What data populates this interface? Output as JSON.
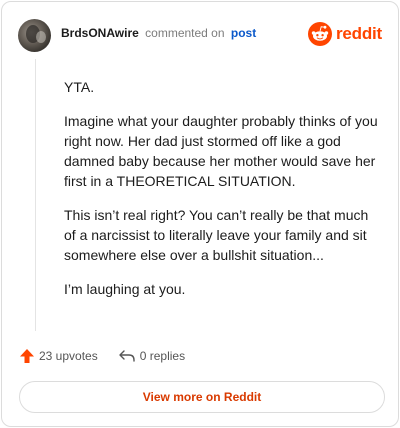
{
  "header": {
    "username": "BrdsONAwire",
    "action_text": "commented on",
    "post_link": "post",
    "brand": "reddit"
  },
  "comment": {
    "paragraphs": [
      "YTA.",
      "Imagine what your daughter probably thinks of you right now. Her dad just stormed off like a god damned baby because her mother would save her first in a THEORETICAL SITUATION.",
      "This isn’t real right? You can’t really be that much of a narcissist to literally leave your family and sit somewhere else over a bullshit situation...",
      "I’m laughing at you."
    ]
  },
  "footer": {
    "upvotes": "23 upvotes",
    "replies": "0 replies"
  },
  "view_more": "View more on Reddit",
  "colors": {
    "brand": "#ff4500",
    "link": "#0a58ca",
    "view_more": "#d93a00"
  }
}
